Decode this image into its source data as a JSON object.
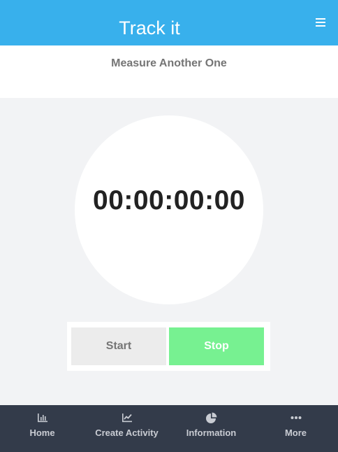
{
  "header": {
    "title": "Track it",
    "menu_icon": "hamburger-menu-icon",
    "background": "#38b0ec"
  },
  "subheader": {
    "title": "Measure Another One"
  },
  "timer": {
    "display": "00:00:00:00"
  },
  "controls": {
    "start_label": "Start",
    "stop_label": "Stop",
    "stop_color": "#77f191"
  },
  "bottom_nav": {
    "background": "#333b4a",
    "items": [
      {
        "label": "Home",
        "icon": "bar-chart-icon"
      },
      {
        "label": "Create Activity",
        "icon": "line-chart-icon"
      },
      {
        "label": "Information",
        "icon": "pie-chart-icon"
      },
      {
        "label": "More",
        "icon": "more-dots-icon"
      }
    ]
  }
}
